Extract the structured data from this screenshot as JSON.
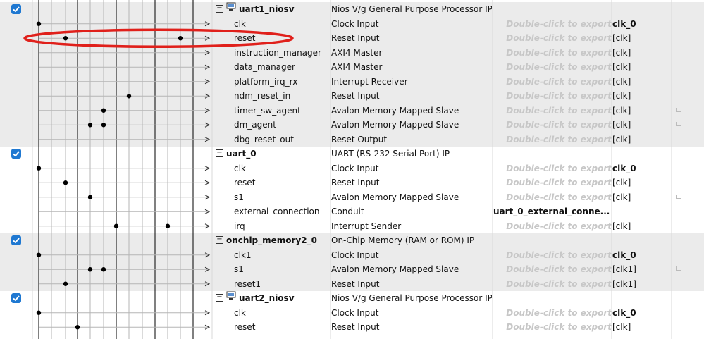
{
  "export_hint": "Double-click to export",
  "components": [
    {
      "name": "uart1_niosv",
      "description": "Nios V/g General Purpose Processor IP",
      "icon": "cpu-icon",
      "checked": true,
      "ports": [
        {
          "name": "clk",
          "type": "Clock Input",
          "export": "Double-click to export",
          "clock": "clk_0",
          "clock_bold": true
        },
        {
          "name": "reset",
          "type": "Reset Input",
          "export": "Double-click to export",
          "clock": "[clk]"
        },
        {
          "name": "instruction_manager",
          "type": "AXI4 Master",
          "export": "Double-click to export",
          "clock": "[clk]"
        },
        {
          "name": "data_manager",
          "type": "AXI4 Master",
          "export": "Double-click to export",
          "clock": "[clk]"
        },
        {
          "name": "platform_irq_rx",
          "type": "Interrupt Receiver",
          "export": "Double-click to export",
          "clock": "[clk]"
        },
        {
          "name": "ndm_reset_in",
          "type": "Reset Input",
          "export": "Double-click to export",
          "clock": "[clk]"
        },
        {
          "name": "timer_sw_agent",
          "type": "Avalon Memory Mapped Slave",
          "export": "Double-click to export",
          "clock": "[clk]",
          "lock": true
        },
        {
          "name": "dm_agent",
          "type": "Avalon Memory Mapped Slave",
          "export": "Double-click to export",
          "clock": "[clk]",
          "lock": true
        },
        {
          "name": "dbg_reset_out",
          "type": "Reset Output",
          "export": "Double-click to export",
          "clock": "[clk]"
        }
      ]
    },
    {
      "name": "uart_0",
      "description": "UART (RS-232 Serial Port) IP",
      "icon": "",
      "checked": true,
      "ports": [
        {
          "name": "clk",
          "type": "Clock Input",
          "export": "Double-click to export",
          "clock": "clk_0",
          "clock_bold": true
        },
        {
          "name": "reset",
          "type": "Reset Input",
          "export": "Double-click to export",
          "clock": "[clk]"
        },
        {
          "name": "s1",
          "type": "Avalon Memory Mapped Slave",
          "export": "Double-click to export",
          "clock": "[clk]",
          "lock": true
        },
        {
          "name": "external_connection",
          "type": "Conduit",
          "export": "uart_0_external_conne...",
          "export_bold": true,
          "clock": ""
        },
        {
          "name": "irq",
          "type": "Interrupt Sender",
          "export": "Double-click to export",
          "clock": "[clk]"
        }
      ]
    },
    {
      "name": "onchip_memory2_0",
      "description": "On-Chip Memory (RAM or ROM) IP",
      "icon": "",
      "checked": true,
      "ports": [
        {
          "name": "clk1",
          "type": "Clock Input",
          "export": "Double-click to export",
          "clock": "clk_0",
          "clock_bold": true
        },
        {
          "name": "s1",
          "type": "Avalon Memory Mapped Slave",
          "export": "Double-click to export",
          "clock": "[clk1]",
          "lock": true
        },
        {
          "name": "reset1",
          "type": "Reset Input",
          "export": "Double-click to export",
          "clock": "[clk1]"
        }
      ]
    },
    {
      "name": "uart2_niosv",
      "description": "Nios V/g General Purpose Processor IP",
      "icon": "cpu-icon",
      "checked": true,
      "ports": [
        {
          "name": "clk",
          "type": "Clock Input",
          "export": "Double-click to export",
          "clock": "clk_0",
          "clock_bold": true
        },
        {
          "name": "reset",
          "type": "Reset Input",
          "export": "Double-click to export",
          "clock": "[clk]"
        }
      ]
    }
  ],
  "colors": {
    "row_shaded": "#ebebeb",
    "row_white": "#ffffff",
    "grid_line": "#d8d8d8",
    "wire": "#000000",
    "wire_faint": "#b5b5b5",
    "checkbox": "#1f78d1",
    "highlight_ellipse": "#e0201b"
  }
}
